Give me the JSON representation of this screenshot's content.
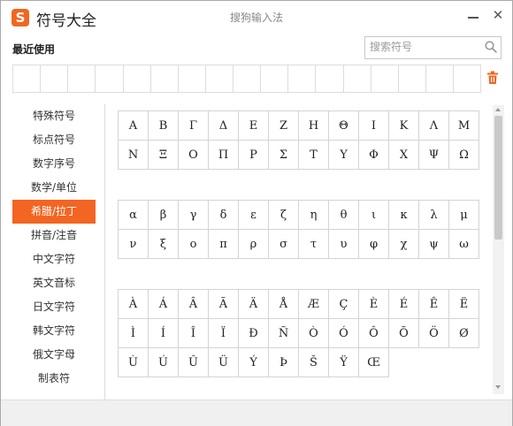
{
  "title_bar": {
    "logo_letter": "S",
    "app_title": "符号大全",
    "subtitle": "搜狗输入法"
  },
  "recent": {
    "label": "最近使用",
    "cells": [
      "",
      "",
      "",
      "",
      "",
      "",
      "",
      "",
      "",
      "",
      "",
      "",
      "",
      "",
      "",
      "",
      ""
    ]
  },
  "search": {
    "placeholder": "搜索符号",
    "value": ""
  },
  "sidebar": {
    "items": [
      {
        "label": "特殊符号",
        "active": false
      },
      {
        "label": "标点符号",
        "active": false
      },
      {
        "label": "数字序号",
        "active": false
      },
      {
        "label": "数学/单位",
        "active": false
      },
      {
        "label": "希腊/拉丁",
        "active": true
      },
      {
        "label": "拼音/注音",
        "active": false
      },
      {
        "label": "中文字符",
        "active": false
      },
      {
        "label": "英文音标",
        "active": false
      },
      {
        "label": "日文字符",
        "active": false
      },
      {
        "label": "韩文字符",
        "active": false
      },
      {
        "label": "俄文字母",
        "active": false
      },
      {
        "label": "制表符",
        "active": false
      }
    ]
  },
  "symbols": {
    "greek_upper": [
      "Α",
      "Β",
      "Γ",
      "Δ",
      "Ε",
      "Ζ",
      "Η",
      "Θ",
      "Ι",
      "Κ",
      "Λ",
      "Μ",
      "Ν",
      "Ξ",
      "Ο",
      "Π",
      "Ρ",
      "Σ",
      "Τ",
      "Υ",
      "Φ",
      "Χ",
      "Ψ",
      "Ω"
    ],
    "greek_lower": [
      "α",
      "β",
      "γ",
      "δ",
      "ε",
      "ζ",
      "η",
      "θ",
      "ι",
      "κ",
      "λ",
      "μ",
      "ν",
      "ξ",
      "ο",
      "π",
      "ρ",
      "σ",
      "τ",
      "υ",
      "φ",
      "χ",
      "ψ",
      "ω"
    ],
    "latin": [
      "À",
      "Á",
      "Â",
      "Ã",
      "Ä",
      "Å",
      "Æ",
      "Ç",
      "È",
      "É",
      "Ê",
      "Ë",
      "Ì",
      "Í",
      "Î",
      "Ï",
      "Ð",
      "Ñ",
      "Ò",
      "Ó",
      "Ô",
      "Õ",
      "Ö",
      "Ø",
      "Ù",
      "Ú",
      "Û",
      "Ü",
      "Ý",
      "Þ",
      "Š",
      "Ÿ",
      "Œ"
    ]
  },
  "colors": {
    "accent": "#f26522",
    "grid_border": "#d4d4d4"
  },
  "icons": {
    "search": "search-icon",
    "trash": "trash-icon",
    "minimize": "minimize-icon",
    "close": "close-icon"
  }
}
